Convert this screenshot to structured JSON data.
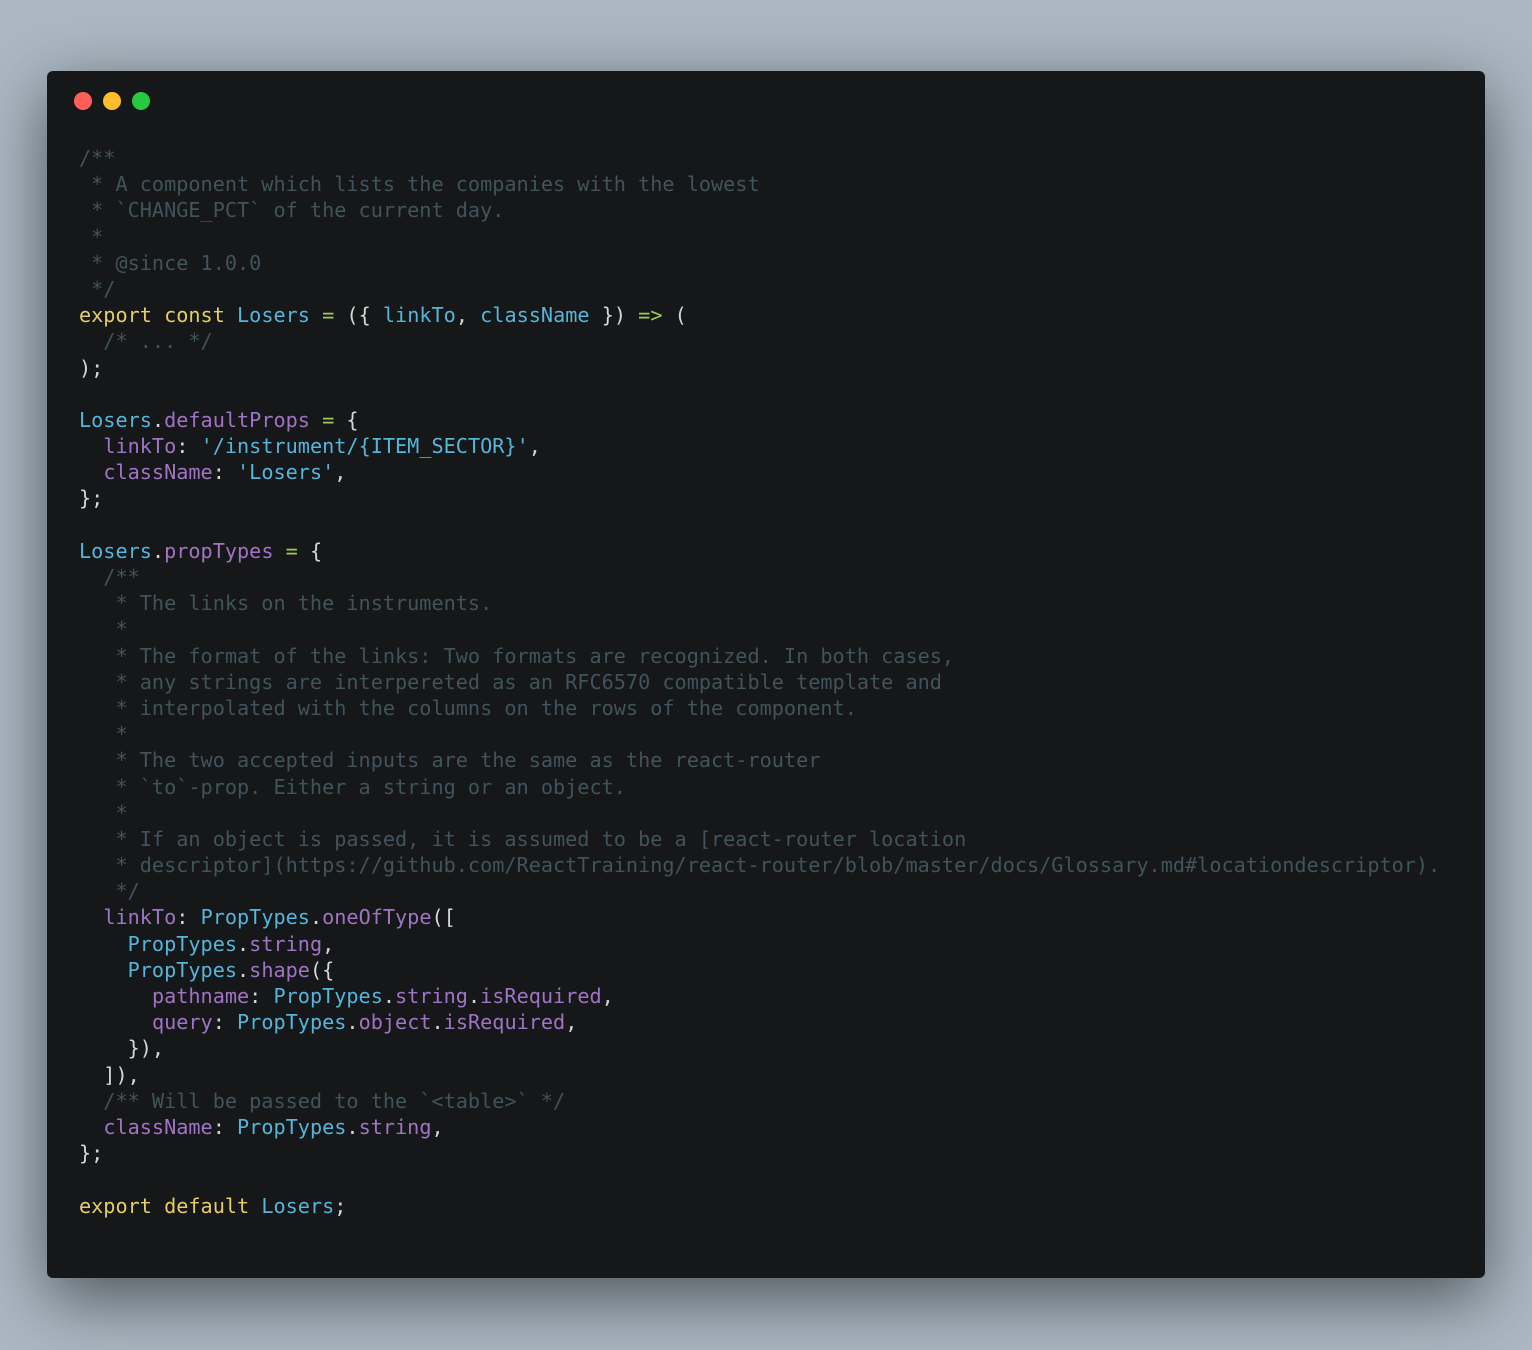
{
  "window": {
    "controls": [
      "close",
      "minimize",
      "maximize"
    ],
    "colors": {
      "background": "#abb8c3",
      "editor": "#151718",
      "comment": "#41535b",
      "keyword": "#e6cd69",
      "identifier": "#55b5db",
      "property": "#a074c4",
      "operator": "#9fca56",
      "plain": "#d4d7d6"
    }
  },
  "code": {
    "lines": [
      [
        {
          "t": "cm",
          "s": "/**"
        }
      ],
      [
        {
          "t": "cm",
          "s": " * A component which lists the companies with the lowest"
        }
      ],
      [
        {
          "t": "cm",
          "s": " * `CHANGE_PCT` of the current day."
        }
      ],
      [
        {
          "t": "cm",
          "s": " *"
        }
      ],
      [
        {
          "t": "cm",
          "s": " * @since 1.0.0"
        }
      ],
      [
        {
          "t": "cm",
          "s": " */"
        }
      ],
      [
        {
          "t": "kw",
          "s": "export"
        },
        {
          "t": "pl",
          "s": " "
        },
        {
          "t": "kw",
          "s": "const"
        },
        {
          "t": "pl",
          "s": " "
        },
        {
          "t": "id",
          "s": "Losers"
        },
        {
          "t": "pl",
          "s": " "
        },
        {
          "t": "op",
          "s": "="
        },
        {
          "t": "pl",
          "s": " ({ "
        },
        {
          "t": "id",
          "s": "linkTo"
        },
        {
          "t": "pl",
          "s": ", "
        },
        {
          "t": "id",
          "s": "className"
        },
        {
          "t": "pl",
          "s": " }) "
        },
        {
          "t": "op",
          "s": "=>"
        },
        {
          "t": "pl",
          "s": " ("
        }
      ],
      [
        {
          "t": "cm",
          "s": "  /* ... */"
        }
      ],
      [
        {
          "t": "pl",
          "s": ");"
        }
      ],
      [],
      [
        {
          "t": "id",
          "s": "Losers"
        },
        {
          "t": "pl",
          "s": "."
        },
        {
          "t": "pr",
          "s": "defaultProps"
        },
        {
          "t": "pl",
          "s": " "
        },
        {
          "t": "op",
          "s": "="
        },
        {
          "t": "pl",
          "s": " {"
        }
      ],
      [
        {
          "t": "pl",
          "s": "  "
        },
        {
          "t": "pr",
          "s": "linkTo"
        },
        {
          "t": "pl",
          "s": ": "
        },
        {
          "t": "st",
          "s": "'/instrument/{ITEM_SECTOR}'"
        },
        {
          "t": "pl",
          "s": ","
        }
      ],
      [
        {
          "t": "pl",
          "s": "  "
        },
        {
          "t": "pr",
          "s": "className"
        },
        {
          "t": "pl",
          "s": ": "
        },
        {
          "t": "st",
          "s": "'Losers'"
        },
        {
          "t": "pl",
          "s": ","
        }
      ],
      [
        {
          "t": "pl",
          "s": "};"
        }
      ],
      [],
      [
        {
          "t": "id",
          "s": "Losers"
        },
        {
          "t": "pl",
          "s": "."
        },
        {
          "t": "pr",
          "s": "propTypes"
        },
        {
          "t": "pl",
          "s": " "
        },
        {
          "t": "op",
          "s": "="
        },
        {
          "t": "pl",
          "s": " {"
        }
      ],
      [
        {
          "t": "cm",
          "s": "  /**"
        }
      ],
      [
        {
          "t": "cm",
          "s": "   * The links on the instruments."
        }
      ],
      [
        {
          "t": "cm",
          "s": "   *"
        }
      ],
      [
        {
          "t": "cm",
          "s": "   * The format of the links: Two formats are recognized. In both cases,"
        }
      ],
      [
        {
          "t": "cm",
          "s": "   * any strings are interpereted as an RFC6570 compatible template and"
        }
      ],
      [
        {
          "t": "cm",
          "s": "   * interpolated with the columns on the rows of the component."
        }
      ],
      [
        {
          "t": "cm",
          "s": "   *"
        }
      ],
      [
        {
          "t": "cm",
          "s": "   * The two accepted inputs are the same as the react-router"
        }
      ],
      [
        {
          "t": "cm",
          "s": "   * `to`-prop. Either a string or an object."
        }
      ],
      [
        {
          "t": "cm",
          "s": "   *"
        }
      ],
      [
        {
          "t": "cm",
          "s": "   * If an object is passed, it is assumed to be a [react-router location"
        }
      ],
      [
        {
          "t": "cm",
          "s": "   * descriptor](https://github.com/ReactTraining/react-router/blob/master/docs/Glossary.md#locationdescriptor)."
        }
      ],
      [
        {
          "t": "cm",
          "s": "   */"
        }
      ],
      [
        {
          "t": "pl",
          "s": "  "
        },
        {
          "t": "pr",
          "s": "linkTo"
        },
        {
          "t": "pl",
          "s": ": "
        },
        {
          "t": "id",
          "s": "PropTypes"
        },
        {
          "t": "pl",
          "s": "."
        },
        {
          "t": "pr",
          "s": "oneOfType"
        },
        {
          "t": "pl",
          "s": "(["
        }
      ],
      [
        {
          "t": "pl",
          "s": "    "
        },
        {
          "t": "id",
          "s": "PropTypes"
        },
        {
          "t": "pl",
          "s": "."
        },
        {
          "t": "pr",
          "s": "string"
        },
        {
          "t": "pl",
          "s": ","
        }
      ],
      [
        {
          "t": "pl",
          "s": "    "
        },
        {
          "t": "id",
          "s": "PropTypes"
        },
        {
          "t": "pl",
          "s": "."
        },
        {
          "t": "pr",
          "s": "shape"
        },
        {
          "t": "pl",
          "s": "({"
        }
      ],
      [
        {
          "t": "pl",
          "s": "      "
        },
        {
          "t": "pr",
          "s": "pathname"
        },
        {
          "t": "pl",
          "s": ": "
        },
        {
          "t": "id",
          "s": "PropTypes"
        },
        {
          "t": "pl",
          "s": "."
        },
        {
          "t": "pr",
          "s": "string"
        },
        {
          "t": "pl",
          "s": "."
        },
        {
          "t": "pr",
          "s": "isRequired"
        },
        {
          "t": "pl",
          "s": ","
        }
      ],
      [
        {
          "t": "pl",
          "s": "      "
        },
        {
          "t": "pr",
          "s": "query"
        },
        {
          "t": "pl",
          "s": ": "
        },
        {
          "t": "id",
          "s": "PropTypes"
        },
        {
          "t": "pl",
          "s": "."
        },
        {
          "t": "pr",
          "s": "object"
        },
        {
          "t": "pl",
          "s": "."
        },
        {
          "t": "pr",
          "s": "isRequired"
        },
        {
          "t": "pl",
          "s": ","
        }
      ],
      [
        {
          "t": "pl",
          "s": "    }),"
        }
      ],
      [
        {
          "t": "pl",
          "s": "  ]),"
        }
      ],
      [
        {
          "t": "cm",
          "s": "  /** Will be passed to the `<table>` */"
        }
      ],
      [
        {
          "t": "pl",
          "s": "  "
        },
        {
          "t": "pr",
          "s": "className"
        },
        {
          "t": "pl",
          "s": ": "
        },
        {
          "t": "id",
          "s": "PropTypes"
        },
        {
          "t": "pl",
          "s": "."
        },
        {
          "t": "pr",
          "s": "string"
        },
        {
          "t": "pl",
          "s": ","
        }
      ],
      [
        {
          "t": "pl",
          "s": "};"
        }
      ],
      [],
      [
        {
          "t": "kw",
          "s": "export"
        },
        {
          "t": "pl",
          "s": " "
        },
        {
          "t": "kw",
          "s": "default"
        },
        {
          "t": "pl",
          "s": " "
        },
        {
          "t": "id",
          "s": "Losers"
        },
        {
          "t": "pl",
          "s": ";"
        }
      ]
    ]
  }
}
